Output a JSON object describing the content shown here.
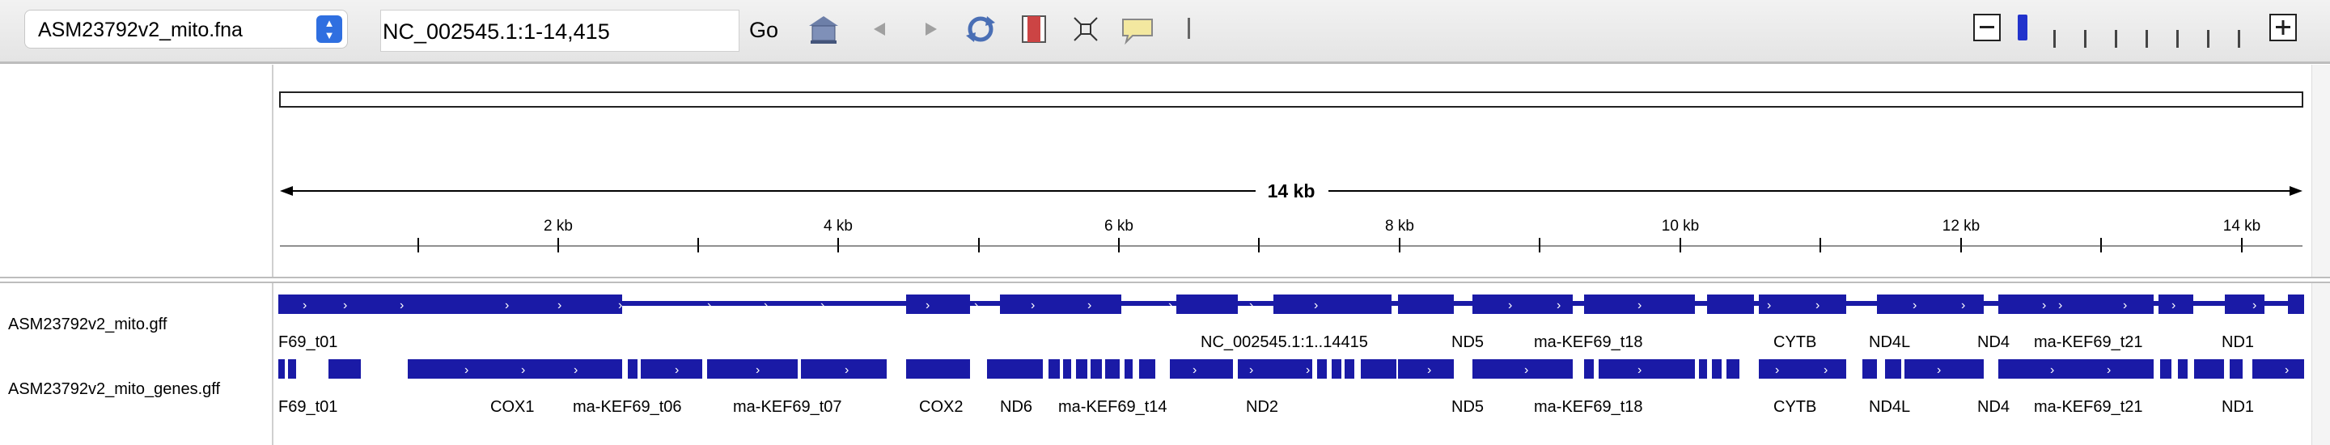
{
  "toolbar": {
    "genome": "ASM23792v2_mito.fna",
    "locus": "NC_002545.1:1-14,415",
    "go_label": "Go",
    "icons": [
      "home-icon",
      "back-icon",
      "forward-icon",
      "refresh-icon",
      "roi-icon",
      "fit-icon",
      "popup-icon"
    ],
    "zoom_minus": "−",
    "zoom_plus": "+"
  },
  "ruler": {
    "span_label": "14 kb",
    "ticks": [
      "2 kb",
      "4 kb",
      "6 kb",
      "8 kb",
      "10 kb",
      "12 kb",
      "14 kb"
    ]
  },
  "tracks": [
    {
      "name": "ASM23792v2_mito.gff",
      "labels": [
        "F69_t01",
        "NC_002545.1:1..14415",
        "ND5",
        "ma-KEF69_t18",
        "CYTB",
        "ND4L",
        "ND4",
        "ma-KEF69_t21",
        "ND1"
      ]
    },
    {
      "name": "ASM23792v2_mito_genes.gff",
      "labels": [
        "F69_t01",
        "COX1",
        "ma-KEF69_t06",
        "ma-KEF69_t07",
        "COX2",
        "ND6",
        "ma-KEF69_t14",
        "ND2",
        "ND5",
        "ma-KEF69_t18",
        "CYTB",
        "ND4L",
        "ND4",
        "ma-KEF69_t21",
        "ND1"
      ]
    }
  ],
  "colors": {
    "feature": "#1a1aa6",
    "accent": "#2f6fe0"
  }
}
